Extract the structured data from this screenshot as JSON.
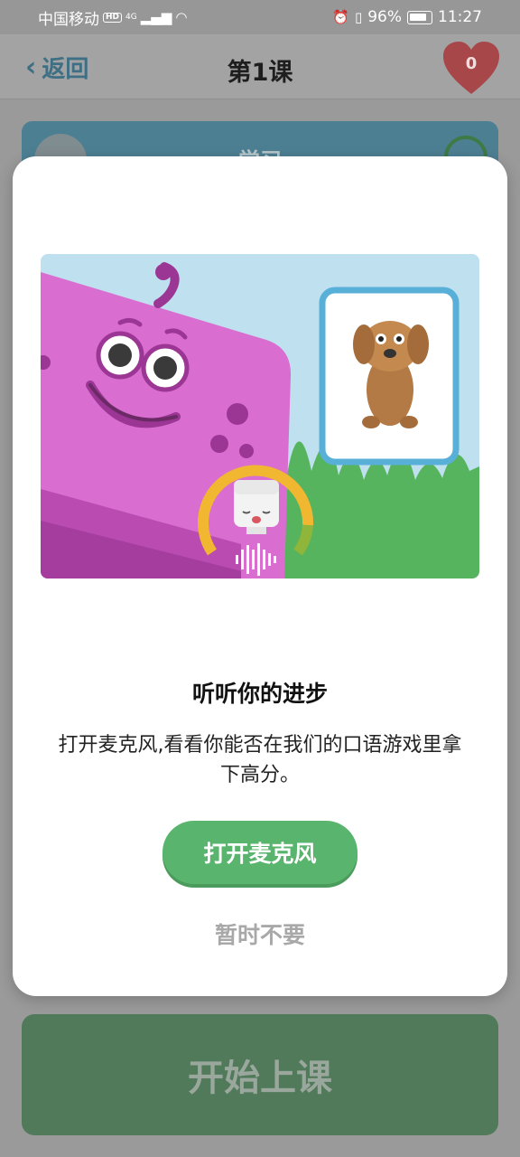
{
  "status_bar": {
    "carrier": "中国移动",
    "hd": "HD",
    "network": "4G",
    "battery": "96%",
    "time": "11:27"
  },
  "header": {
    "back_label": "返回",
    "title": "第1课",
    "hearts": "0"
  },
  "lesson_card": {
    "label": "学习"
  },
  "modal": {
    "title": "听听你的进步",
    "body": "打开麦克风,看看你能否在我们的口语游戏里拿下高分。",
    "primary_button": "打开麦克风",
    "secondary_button": "暂时不要"
  },
  "start_button": "开始上课",
  "colors": {
    "accent_green": "#59b46d",
    "heart_red": "#a8474a",
    "back_blue": "#3f6f84"
  },
  "icons": [
    "back-chevron-icon",
    "heart-icon",
    "alarm-icon",
    "vibrate-icon",
    "battery-icon",
    "wifi-icon",
    "signal-icon",
    "play-icon",
    "star-icon"
  ]
}
